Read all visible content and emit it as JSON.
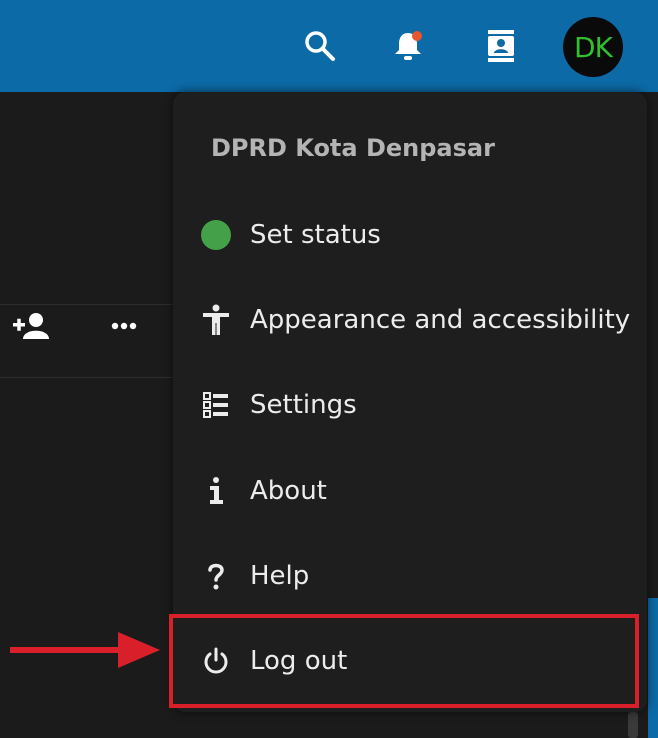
{
  "topbar": {
    "icons": [
      "search-icon",
      "bell-icon",
      "contacts-icon"
    ],
    "avatar_initials": "DK",
    "notification_dot_color": "#e8562f",
    "color": "#0c6aa6"
  },
  "background_panel": {
    "icons": [
      "add-user-icon",
      "more-dots-icon"
    ]
  },
  "user_menu": {
    "display_name": "DPRD Kota Denpasar",
    "items": [
      {
        "label": "Set status",
        "icon": "status-dot-icon"
      },
      {
        "label": "Appearance and accessibility",
        "icon": "accessibility-icon"
      },
      {
        "label": "Settings",
        "icon": "settings-list-icon"
      },
      {
        "label": "About",
        "icon": "info-icon"
      },
      {
        "label": "Help",
        "icon": "help-icon"
      },
      {
        "label": "Log out",
        "icon": "power-icon"
      }
    ],
    "status_color": "#45a04a"
  },
  "annotation": {
    "highlight_color": "#d9202a",
    "highlighted_item": "Log out"
  }
}
